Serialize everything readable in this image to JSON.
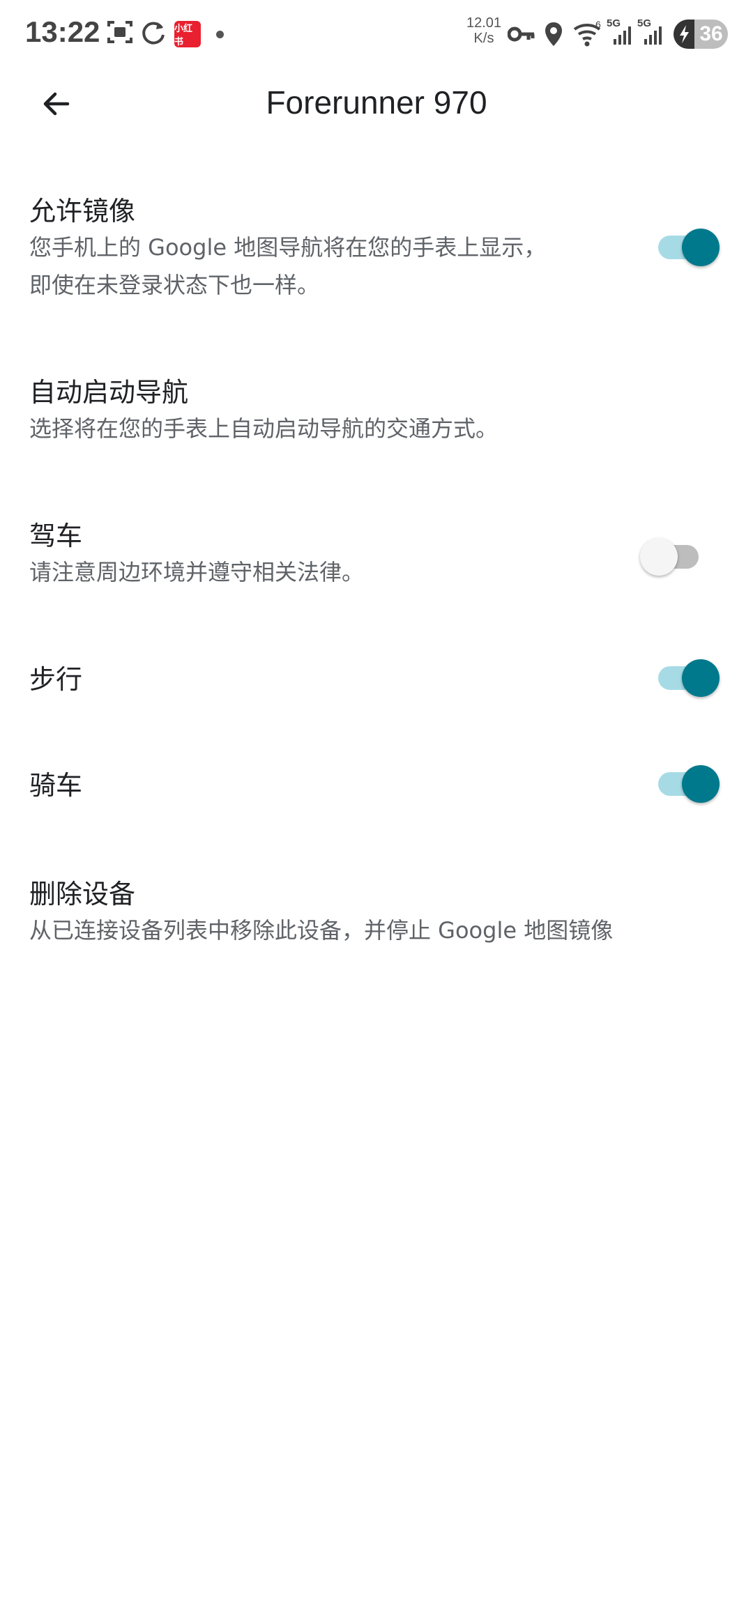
{
  "status_bar": {
    "time": "13:22",
    "app_badge": "小红书",
    "net_speed_value": "12.01",
    "net_speed_unit": "K/s",
    "battery": "36",
    "signal_label_1": "5G",
    "signal_label_2": "5G",
    "wifi_label": "6",
    "icons": [
      "screenshot-icon",
      "sync-icon",
      "app-notification-icon",
      "vpn-key-icon",
      "location-icon",
      "wifi-icon",
      "signal-icon",
      "battery-charging-icon"
    ]
  },
  "app_bar": {
    "title": "Forerunner 970",
    "back_icon": "arrow-back-icon"
  },
  "settings": {
    "allow_mirroring": {
      "title": "允许镜像",
      "desc_line1": "您手机上的 Google 地图导航将在您的手表上显示，",
      "desc_line2": "即使在未登录状态下也一样。",
      "enabled": true
    },
    "auto_start": {
      "title": "自动启动导航",
      "desc": "选择将在您的手表上自动启动导航的交通方式。"
    },
    "driving": {
      "title": "驾车",
      "desc": "请注意周边环境并遵守相关法律。",
      "enabled": false
    },
    "walking": {
      "title": "步行",
      "enabled": true
    },
    "cycling": {
      "title": "骑车",
      "enabled": true
    },
    "remove_device": {
      "title": "删除设备",
      "desc": "从已连接设备列表中移除此设备，并停止 Google 地图镜像"
    }
  },
  "colors": {
    "switch_on_thumb": "#00798c",
    "switch_on_track": "#a6dbe6",
    "switch_off_thumb": "#f5f5f5",
    "switch_off_track": "#bdbdbd"
  }
}
